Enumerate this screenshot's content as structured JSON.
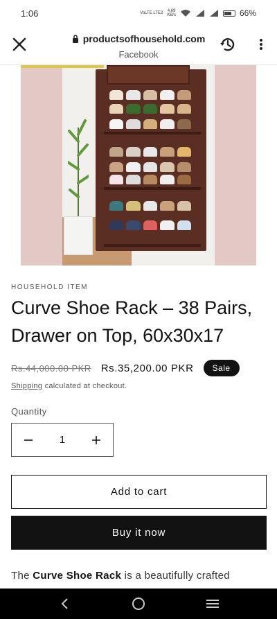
{
  "status_bar": {
    "time": "1:06",
    "network_label": "VoLTE LTE2",
    "speed_value": "4.69",
    "speed_unit": "KB/s",
    "battery": "66%"
  },
  "browser": {
    "url": "productsofhousehold.com",
    "origin": "Facebook",
    "icons": [
      "close-icon",
      "lock-icon",
      "history-icon",
      "more-vert-icon"
    ]
  },
  "product": {
    "vendor": "HOUSEHOLD ITEM",
    "title": "Curve Shoe Rack – 38 Pairs, Drawer on Top, 60x30x17",
    "old_price": "Rs.44,000.00 PKR",
    "price": "Rs.35,200.00 PKR",
    "badge": "Sale",
    "shipping_link": "Shipping",
    "shipping_text": " calculated at checkout.",
    "quantity_label": "Quantity",
    "quantity_value": "1",
    "add_to_cart": "Add to cart",
    "buy_now": "Buy it now",
    "description_prefix": "The ",
    "description_bold": "Curve Shoe Rack",
    "description_suffix": " is a beautifully crafted"
  },
  "colors": {
    "accent": "#121212",
    "image_bg": "#e2c9c6",
    "rack": "#5a2e22"
  },
  "nav_bar": {
    "icons": [
      "back-icon",
      "home-icon",
      "recents-icon"
    ]
  }
}
